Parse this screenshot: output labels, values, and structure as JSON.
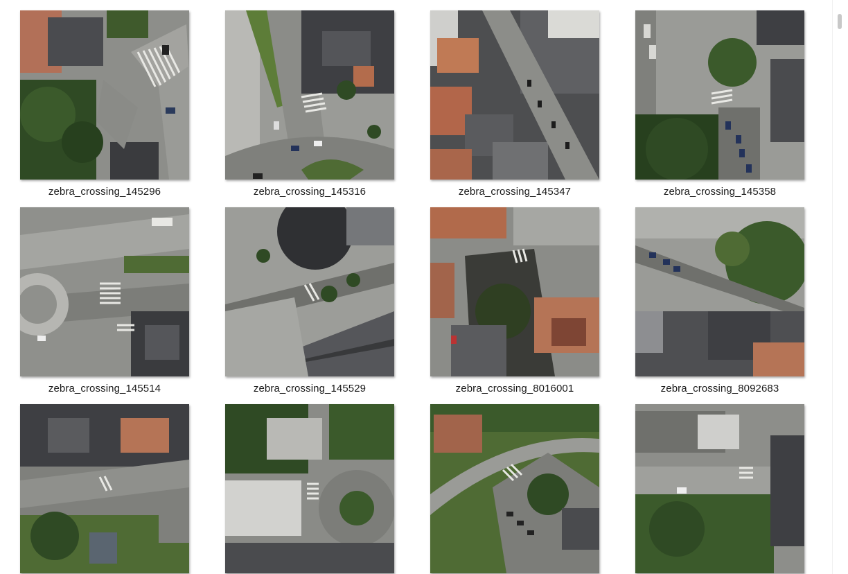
{
  "gallery": {
    "items": [
      {
        "label": "zebra_crossing_145296"
      },
      {
        "label": "zebra_crossing_145316"
      },
      {
        "label": "zebra_crossing_145347"
      },
      {
        "label": "zebra_crossing_145358"
      },
      {
        "label": "zebra_crossing_145514"
      },
      {
        "label": "zebra_crossing_145529"
      },
      {
        "label": "zebra_crossing_8016001"
      },
      {
        "label": "zebra_crossing_8092683"
      },
      {
        "label": ""
      },
      {
        "label": ""
      },
      {
        "label": ""
      },
      {
        "label": ""
      }
    ]
  },
  "colors": {
    "road": "#8c8c88",
    "road_dark": "#6f706c",
    "roof_dark": "#3e3f42",
    "roof_red": "#b9694a",
    "tree": "#2f4a24",
    "tree_light": "#4f6b34",
    "shadow": "#2c2d2a",
    "marking": "#e8e8e4"
  }
}
